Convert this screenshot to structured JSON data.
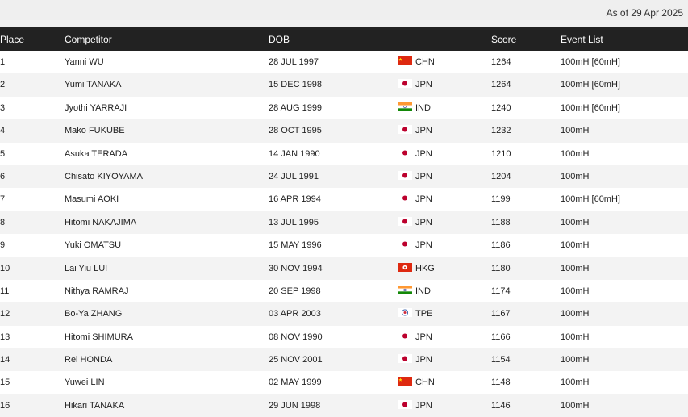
{
  "as_of": "As of 29 Apr 2025",
  "columns": {
    "place": "Place",
    "competitor": "Competitor",
    "dob": "DOB",
    "score": "Score",
    "events": "Event List"
  },
  "rows": [
    {
      "place": "1",
      "competitor": "Yanni WU",
      "dob": "28 JUL 1997",
      "flag": "flag-china-icon",
      "nat": "CHN",
      "score": "1264",
      "events": "100mH [60mH]"
    },
    {
      "place": "2",
      "competitor": "Yumi TANAKA",
      "dob": "15 DEC 1998",
      "flag": "flag-japan-icon",
      "nat": "JPN",
      "score": "1264",
      "events": "100mH [60mH]"
    },
    {
      "place": "3",
      "competitor": "Jyothi YARRAJI",
      "dob": "28 AUG 1999",
      "flag": "flag-india-icon",
      "nat": "IND",
      "score": "1240",
      "events": "100mH [60mH]"
    },
    {
      "place": "4",
      "competitor": "Mako FUKUBE",
      "dob": "28 OCT 1995",
      "flag": "flag-japan-icon",
      "nat": "JPN",
      "score": "1232",
      "events": "100mH"
    },
    {
      "place": "5",
      "competitor": "Asuka TERADA",
      "dob": "14 JAN 1990",
      "flag": "flag-japan-icon",
      "nat": "JPN",
      "score": "1210",
      "events": "100mH"
    },
    {
      "place": "6",
      "competitor": "Chisato KIYOYAMA",
      "dob": "24 JUL 1991",
      "flag": "flag-japan-icon",
      "nat": "JPN",
      "score": "1204",
      "events": "100mH"
    },
    {
      "place": "7",
      "competitor": "Masumi AOKI",
      "dob": "16 APR 1994",
      "flag": "flag-japan-icon",
      "nat": "JPN",
      "score": "1199",
      "events": "100mH [60mH]"
    },
    {
      "place": "8",
      "competitor": "Hitomi NAKAJIMA",
      "dob": "13 JUL 1995",
      "flag": "flag-japan-icon",
      "nat": "JPN",
      "score": "1188",
      "events": "100mH"
    },
    {
      "place": "9",
      "competitor": "Yuki OMATSU",
      "dob": "15 MAY 1996",
      "flag": "flag-japan-icon",
      "nat": "JPN",
      "score": "1186",
      "events": "100mH"
    },
    {
      "place": "10",
      "competitor": "Lai Yiu LUI",
      "dob": "30 NOV 1994",
      "flag": "flag-hongkong-icon",
      "nat": "HKG",
      "score": "1180",
      "events": "100mH"
    },
    {
      "place": "11",
      "competitor": "Nithya RAMRAJ",
      "dob": "20 SEP 1998",
      "flag": "flag-india-icon",
      "nat": "IND",
      "score": "1174",
      "events": "100mH"
    },
    {
      "place": "12",
      "competitor": "Bo-Ya ZHANG",
      "dob": "03 APR 2003",
      "flag": "flag-tpe-icon",
      "nat": "TPE",
      "score": "1167",
      "events": "100mH"
    },
    {
      "place": "13",
      "competitor": "Hitomi SHIMURA",
      "dob": "08 NOV 1990",
      "flag": "flag-japan-icon",
      "nat": "JPN",
      "score": "1166",
      "events": "100mH"
    },
    {
      "place": "14",
      "competitor": "Rei HONDA",
      "dob": "25 NOV 2001",
      "flag": "flag-japan-icon",
      "nat": "JPN",
      "score": "1154",
      "events": "100mH"
    },
    {
      "place": "15",
      "competitor": "Yuwei LIN",
      "dob": "02 MAY 1999",
      "flag": "flag-china-icon",
      "nat": "CHN",
      "score": "1148",
      "events": "100mH"
    },
    {
      "place": "16",
      "competitor": "Hikari TANAKA",
      "dob": "29 JUN 1998",
      "flag": "flag-japan-icon",
      "nat": "JPN",
      "score": "1146",
      "events": "100mH"
    }
  ]
}
